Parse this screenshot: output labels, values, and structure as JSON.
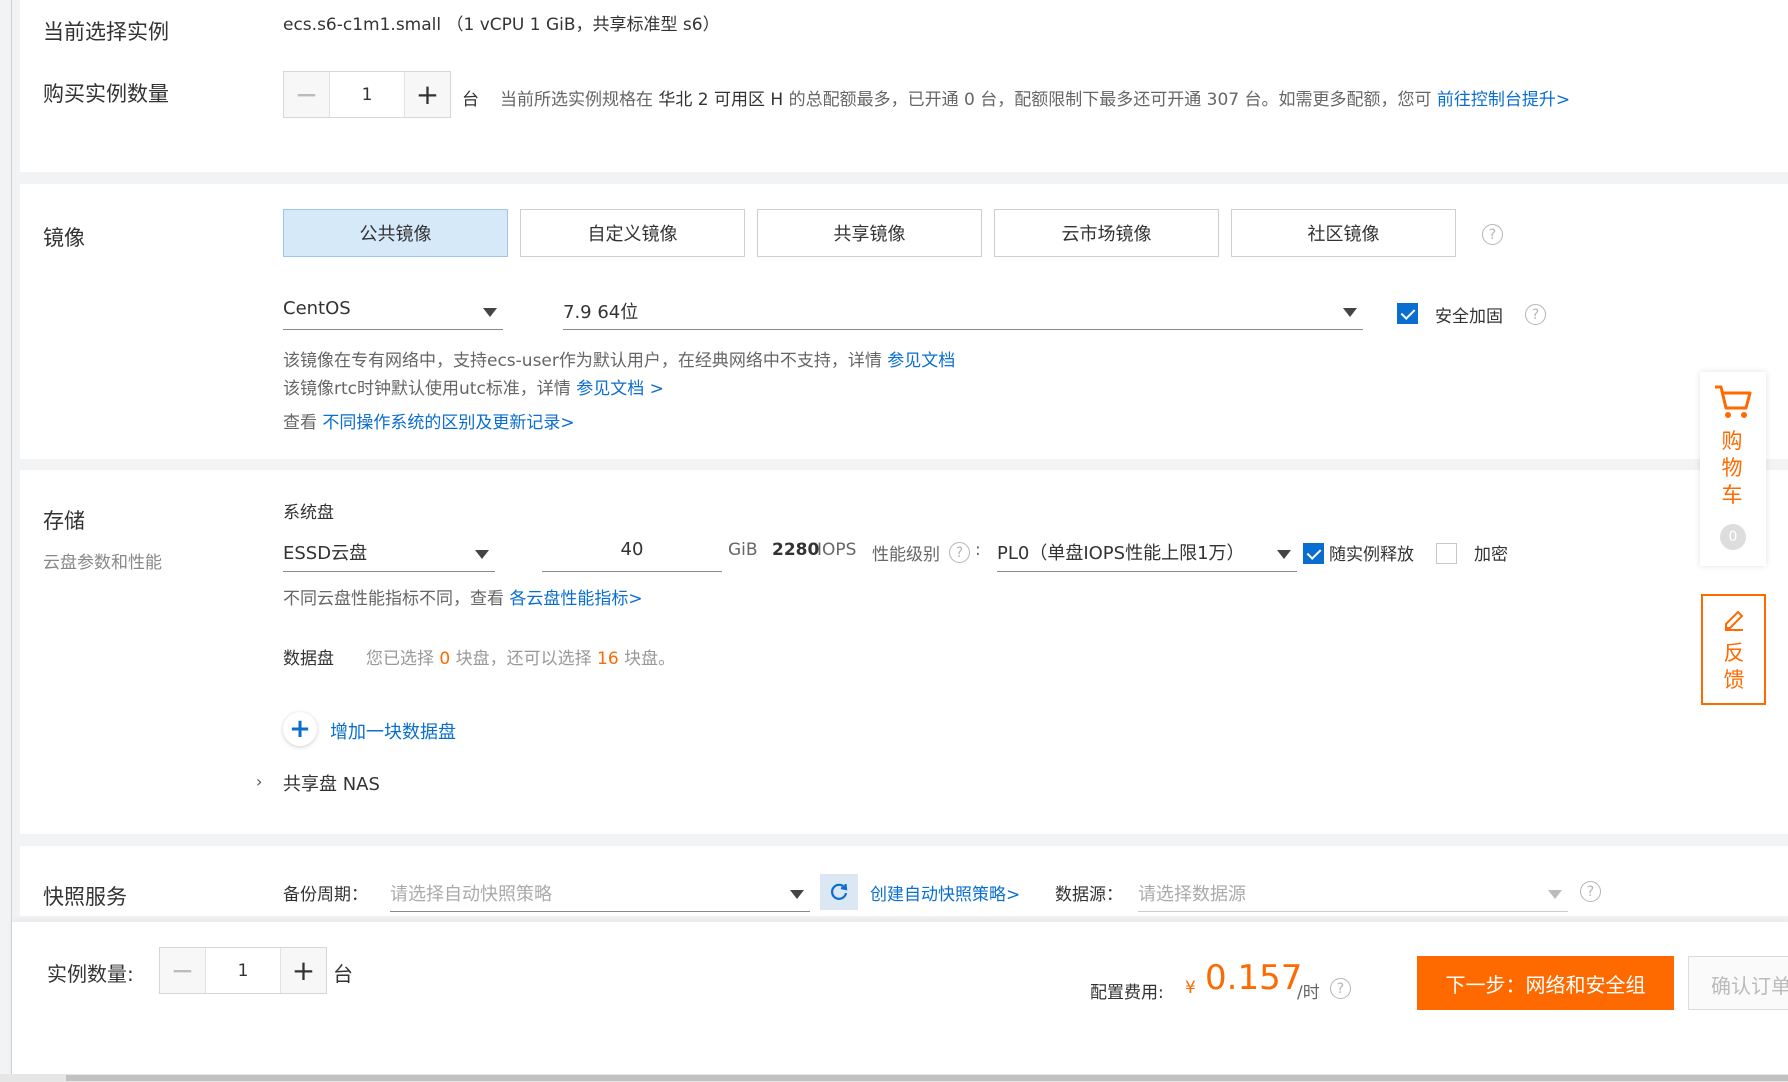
{
  "instance": {
    "current_label": "当前选择实例",
    "current_value": "ecs.s6-c1m1.small （1 vCPU 1 GiB，共享标准型 s6）",
    "qty_label": "购买实例数量",
    "qty_value": "1",
    "qty_unit": "台",
    "quota_pre": "当前所选实例规格在",
    "quota_zone": "华北 2 可用区 H",
    "quota_mid": "的总配额最多，已开通 0 台，配额限制下最多还可开通 307 台。如需更多配额，您可",
    "quota_link": "前往控制台提升>"
  },
  "image": {
    "section_title": "镜像",
    "tabs": [
      {
        "label": "公共镜像",
        "active": true
      },
      {
        "label": "自定义镜像",
        "active": false
      },
      {
        "label": "共享镜像",
        "active": false
      },
      {
        "label": "云市场镜像",
        "active": false
      },
      {
        "label": "社区镜像",
        "active": false
      }
    ],
    "os_value": "CentOS",
    "version_value": "7.9 64位",
    "security_label": "安全加固",
    "security_checked": true,
    "note1_text": "该镜像在专有网络中，支持ecs-user作为默认用户，在经典网络中不支持，详情",
    "note1_link": "参见文档",
    "note2_text": "该镜像rtc时钟默认使用utc标准，详情",
    "note2_link": "参见文档 >",
    "note3_text": "查看",
    "note3_link": "不同操作系统的区别及更新记录>"
  },
  "storage": {
    "section_title": "存储",
    "subtitle": "云盘参数和性能",
    "system_disk_label": "系统盘",
    "disk_type": "ESSD云盘",
    "disk_size": "40",
    "disk_unit": "GiB",
    "iops_value": "2280",
    "iops_unit": "IOPS",
    "perf_label": "性能级别",
    "perf_value": "PL0（单盘IOPS性能上限1万）",
    "release_label": "随实例释放",
    "release_checked": true,
    "encrypt_label": "加密",
    "encrypt_checked": false,
    "perf_note_text": "不同云盘性能指标不同，查看",
    "perf_note_link": "各云盘性能指标>",
    "data_disk_label": "数据盘",
    "data_disk_pre": "您已选择",
    "data_disk_selected": "0",
    "data_disk_mid": "块盘，还可以选择",
    "data_disk_remaining": "16",
    "data_disk_post": "块盘。",
    "add_disk_label": "增加一块数据盘",
    "nas_label": "共享盘 NAS"
  },
  "snapshot": {
    "section_title": "快照服务",
    "period_label": "备份周期：",
    "period_placeholder": "请选择自动快照策略",
    "create_link": "创建自动快照策略>",
    "source_label": "数据源：",
    "source_placeholder": "请选择数据源"
  },
  "footer": {
    "qty_label": "实例数量:",
    "qty_value": "1",
    "qty_unit": "台",
    "fee_label": "配置费用:",
    "currency": "¥",
    "price": "0.157",
    "price_unit": "/时",
    "next_button": "下一步：网络和安全组",
    "confirm_button": "确认订单"
  },
  "side": {
    "cart_label": "购物车",
    "cart_count": "0",
    "feedback_label": "反馈"
  },
  "colors": {
    "accent": "#0a6ed1",
    "orange": "#ff6a00",
    "tab_active_bg": "#d6e9f8"
  }
}
